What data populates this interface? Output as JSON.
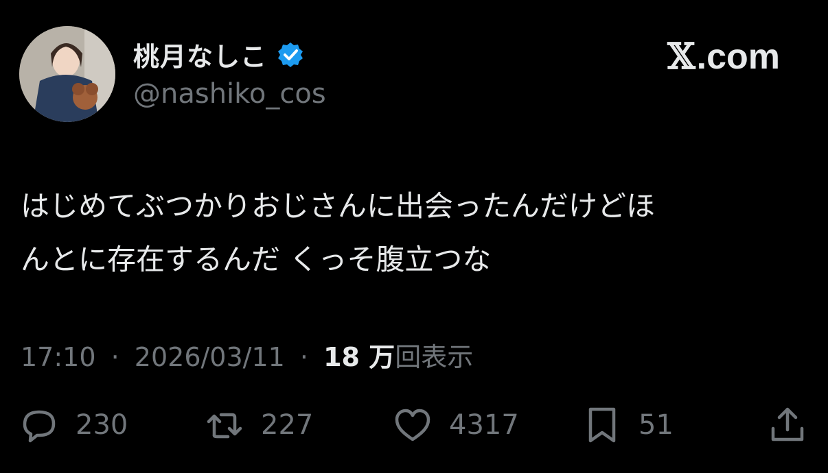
{
  "profile": {
    "display_name": "桃月なしこ",
    "handle": "@nashiko_cos",
    "verified_icon": "verified-badge-icon",
    "verified_color": "#1d9bf0"
  },
  "brand": {
    "mark": "𝕏",
    "text": ".com"
  },
  "tweet": {
    "lines": [
      "はじめてぶつかりおじさんに出会ったんだけどほ",
      "んとに存在するんだ くっそ腹立つな"
    ]
  },
  "meta": {
    "time": "17:10",
    "separator": "·",
    "date": "2026/03/11",
    "views_count": "18 万",
    "views_label": "回表示"
  },
  "actions": {
    "reply_count": "230",
    "retweet_count": "227",
    "like_count": "4317",
    "bookmark_count": "51"
  },
  "colors": {
    "background": "#000000",
    "primary_text": "#e7e9ea",
    "secondary_text": "#71767b"
  }
}
